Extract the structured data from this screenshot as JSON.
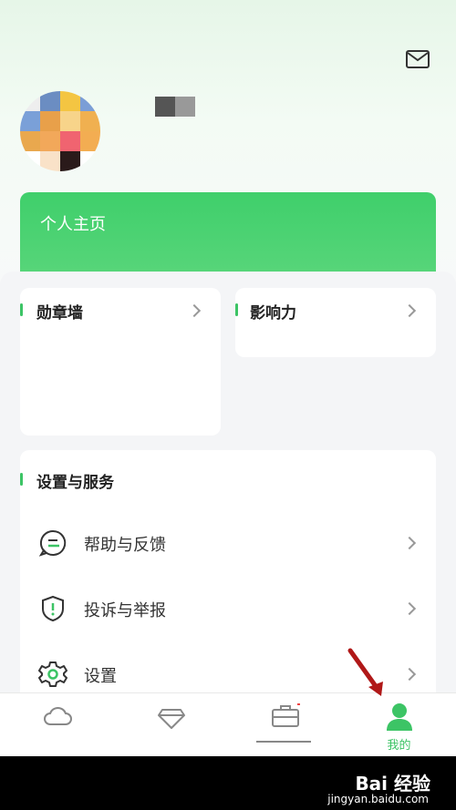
{
  "header": {
    "mail_icon": "mail-icon"
  },
  "profile": {
    "home_label": "个人主页"
  },
  "cards": {
    "badges": "勋章墙",
    "influence": "影响力"
  },
  "services": {
    "title": "设置与服务",
    "items": [
      {
        "label": "帮助与反馈",
        "icon": "chat-help-icon"
      },
      {
        "label": "投诉与举报",
        "icon": "shield-alert-icon"
      },
      {
        "label": "设置",
        "icon": "gear-icon"
      }
    ]
  },
  "tabbar": {
    "tabs": [
      {
        "label": "",
        "icon": "cloud-icon"
      },
      {
        "label": "",
        "icon": "diamond-icon"
      },
      {
        "label": "",
        "icon": "toolbox-icon"
      },
      {
        "label": "我的",
        "icon": "person-icon",
        "active": true
      }
    ]
  },
  "colors": {
    "accent": "#3cc465"
  },
  "watermark": {
    "brand": "Bai 经验",
    "url": "jingyan.baidu.com"
  }
}
